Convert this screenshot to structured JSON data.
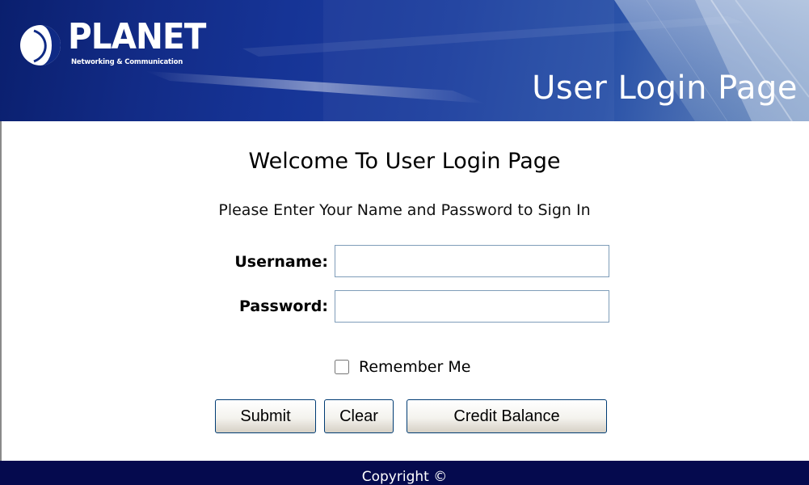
{
  "header": {
    "logo": {
      "name": "PLANET",
      "tagline": "Networking & Communication"
    },
    "title": "User Login Page",
    "color": "#163496"
  },
  "main": {
    "welcome": "Welcome To User Login Page",
    "instructions": "Please Enter Your Name and Password to Sign In",
    "username": {
      "label": "Username:",
      "value": ""
    },
    "password": {
      "label": "Password:",
      "value": ""
    },
    "remember": {
      "label": "Remember Me",
      "checked": false
    },
    "buttons": {
      "submit": "Submit",
      "clear": "Clear",
      "credit_balance": "Credit Balance"
    }
  },
  "footer": {
    "copyright": "Copyright ©",
    "color": "#050a4e"
  }
}
